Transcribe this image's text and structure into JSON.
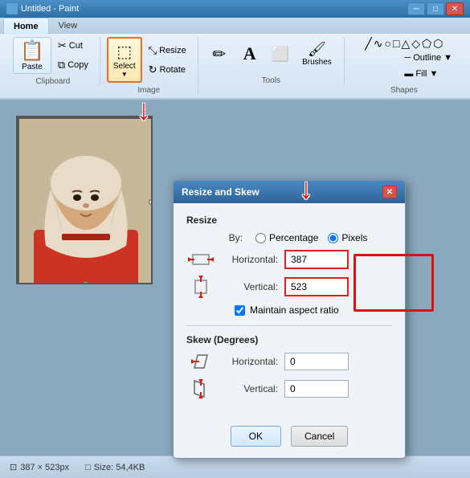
{
  "app": {
    "title": "Untitled - Paint",
    "tabs": [
      "Home",
      "View"
    ]
  },
  "ribbon": {
    "groups": [
      {
        "name": "Clipboard",
        "buttons": [
          "Paste",
          "Cut",
          "Copy"
        ]
      },
      {
        "name": "Image",
        "buttons": [
          "Select",
          "Resize",
          "Rotate"
        ]
      },
      {
        "name": "Tools",
        "buttons": [
          "Pencil",
          "Text",
          "Fill",
          "Brushes"
        ]
      },
      {
        "name": "Shapes",
        "buttons": []
      }
    ],
    "clipboard_label": "Clipboard",
    "image_label": "Image",
    "tools_label": "Tools",
    "shapes_label": "Shapes",
    "paste_label": "Paste",
    "cut_label": "Cut",
    "copy_label": "Copy",
    "select_label": "Select",
    "resize_label": "Resize",
    "rotate_label": "Rotate"
  },
  "dialog": {
    "title": "Resize and Skew",
    "resize_section": "Resize",
    "by_label": "By:",
    "percentage_label": "Percentage",
    "pixels_label": "Pixels",
    "horizontal_label": "Horizontal:",
    "vertical_label": "Vertical:",
    "horizontal_value": "387",
    "vertical_value": "523",
    "maintain_aspect": "Maintain aspect ratio",
    "skew_section": "Skew (Degrees)",
    "skew_horizontal_label": "Horizontal:",
    "skew_vertical_label": "Vertical:",
    "skew_horizontal_value": "0",
    "skew_vertical_value": "0",
    "ok_label": "OK",
    "cancel_label": "Cancel"
  },
  "status_bar": {
    "dimensions_icon": "⊡",
    "dimensions": "387 × 523px",
    "size_icon": "□",
    "size": "Size: 54,4KB"
  }
}
